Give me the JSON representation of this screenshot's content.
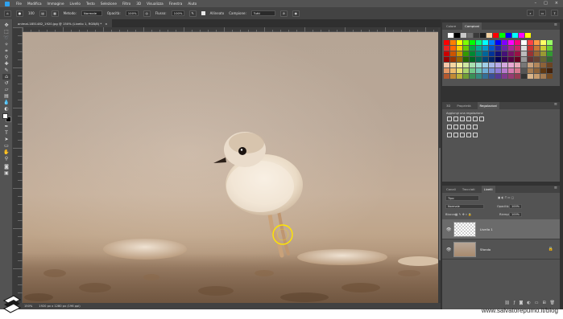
{
  "menu": {
    "items": [
      "File",
      "Modifica",
      "Immagine",
      "Livello",
      "Testo",
      "Selezione",
      "Filtro",
      "3D",
      "Visualizza",
      "Finestra",
      "Aiuto"
    ]
  },
  "options": {
    "brush_size": "100",
    "mode_label": "Metodo:",
    "mode_value": "Normale",
    "opacity_label": "Opacità:",
    "opacity_value": "100%",
    "flow_label": "Flusso:",
    "flow_value": "100%",
    "smoothing_label": "Allineato",
    "sample_label": "Campione:",
    "sample_value": "Tutti"
  },
  "document": {
    "tab_title": "animal-1851482_1920.jpg @ 150% (Livello 1, RGB/8) *",
    "close_symbol": "×"
  },
  "status": {
    "zoom": "150%",
    "doc_info": "1920 px x 1280 px (196 ppi)"
  },
  "panels": {
    "swatches_tabs": [
      "Colore",
      "Campioni"
    ],
    "properties_tabs": [
      "3D",
      "Proprietà",
      "Regolazioni"
    ],
    "adjustments_title": "Aggiungi una regolazione",
    "layers_tabs": [
      "Canali",
      "Tracciati",
      "Livelli"
    ],
    "layer_filter": "Tipo",
    "blend_mode": "Normale",
    "opacity_label": "Opacità:",
    "opacity_value": "100%",
    "lock_label": "Blocca:",
    "fill_label": "Riempi:",
    "fill_value": "100%",
    "layers": [
      {
        "name": "Livello 1",
        "selected": true
      },
      {
        "name": "Sfondo",
        "selected": false
      }
    ]
  },
  "swatch_colors": {
    "recent": [
      "#ffffff",
      "#000000",
      "#c8c8c8",
      "#6f6f6f",
      "#3a3a3a",
      "#1e1e1e",
      "#f2d0a0",
      "#ff0000",
      "#00ff00",
      "#0000ff",
      "#00ffff",
      "#ff00ff",
      "#ffff00"
    ],
    "grid": [
      "#ff0000",
      "#ff7f00",
      "#ffff00",
      "#7fff00",
      "#00ff00",
      "#00ff7f",
      "#00ffff",
      "#007fff",
      "#0000ff",
      "#7f00ff",
      "#ff00ff",
      "#ff007f",
      "#ffffff",
      "#ff4444",
      "#ff9944",
      "#ffff66",
      "#99ff66",
      "#ee2222",
      "#ff6600",
      "#ffcc00",
      "#66cc00",
      "#00aa44",
      "#00aa99",
      "#0099cc",
      "#0055cc",
      "#2222aa",
      "#6622aa",
      "#aa2299",
      "#cc2266",
      "#dddddd",
      "#cc3333",
      "#cc7733",
      "#cccc33",
      "#66cc33",
      "#cc0000",
      "#cc5500",
      "#cc9900",
      "#339900",
      "#008833",
      "#008877",
      "#006699",
      "#003399",
      "#111177",
      "#441177",
      "#771166",
      "#991144",
      "#bbbbbb",
      "#993333",
      "#996633",
      "#999933",
      "#339933",
      "#990000",
      "#993300",
      "#996600",
      "#226600",
      "#006622",
      "#006655",
      "#004477",
      "#002266",
      "#000055",
      "#330055",
      "#550044",
      "#660022",
      "#999999",
      "#663333",
      "#664433",
      "#666633",
      "#336633",
      "#f7c6a8",
      "#f5d6a0",
      "#f5efa0",
      "#cfe8a0",
      "#a8e0b0",
      "#a0ddd4",
      "#a0cfe8",
      "#a8b8e8",
      "#b8a8e8",
      "#d4a8e0",
      "#e8a8d4",
      "#e8a8b8",
      "#777777",
      "#c9a27e",
      "#b3865a",
      "#8d6239",
      "#6b4423",
      "#e59866",
      "#eebd6e",
      "#e8df72",
      "#a9d36e",
      "#72c98a",
      "#6ec4b8",
      "#6eaed6",
      "#7a8fd6",
      "#8e7ad6",
      "#b67acc",
      "#d67ab0",
      "#d6788e",
      "#555555",
      "#a67c52",
      "#8c6239",
      "#603913",
      "#42210b",
      "#b4592f",
      "#c28a35",
      "#bdb33a",
      "#6f9e36",
      "#3a8f58",
      "#358a7f",
      "#356f96",
      "#3b4f96",
      "#553b96",
      "#7f3b8c",
      "#963b72",
      "#963b52",
      "#333333",
      "#d8b48a",
      "#c69c6d",
      "#a57c52",
      "#754c24"
    ]
  },
  "photo": {
    "subject": "bird"
  },
  "watermark": "www.salvatorepumo.it/blog"
}
